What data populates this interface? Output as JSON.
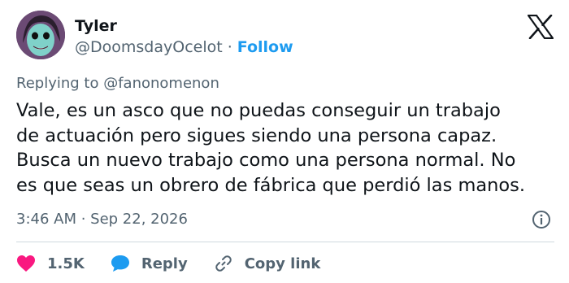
{
  "author": {
    "name": "Tyler",
    "handle": "@DoomsdayOcelot",
    "separator": "·",
    "follow_label": "Follow"
  },
  "reply_context": {
    "prefix": "Replying to ",
    "target": "@fanonomenon"
  },
  "tweet": {
    "text": "Vale, es un asco que no puedas conseguir un trabajo\nde actuación pero sigues siendo una persona capaz.\nBusca un nuevo trabajo como una persona normal. No\nes que seas un obrero de fábrica que perdió las manos.",
    "timestamp": "3:46 AM · Sep 22, 2026"
  },
  "actions": {
    "like_count": "1.5K",
    "reply_label": "Reply",
    "copy_link_label": "Copy link"
  },
  "icons": [
    "x-logo-icon",
    "info-icon",
    "heart-icon",
    "reply-bubble-icon",
    "link-icon"
  ],
  "colors": {
    "text": "#0f1419",
    "secondary": "#536471",
    "accent": "#1d9bf0",
    "heart": "#f91880",
    "divider": "#cfd9de"
  }
}
